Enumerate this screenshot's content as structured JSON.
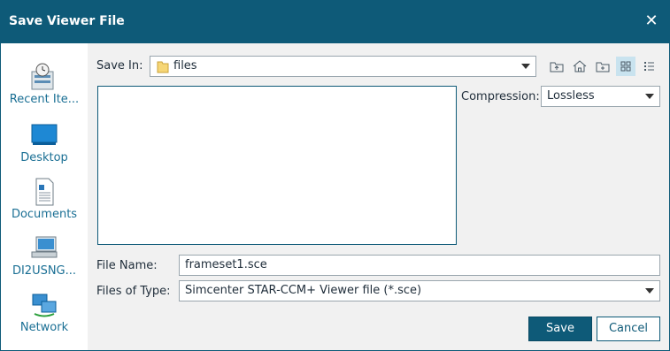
{
  "window": {
    "title": "Save Viewer File",
    "close_icon": "close-icon"
  },
  "sidebar": {
    "items": [
      {
        "label": "Recent Ite...",
        "icon": "recent-items-icon"
      },
      {
        "label": "Desktop",
        "icon": "desktop-icon"
      },
      {
        "label": "Documents",
        "icon": "documents-icon"
      },
      {
        "label": "DI2USNG...",
        "icon": "computer-icon"
      },
      {
        "label": "Network",
        "icon": "network-icon"
      }
    ]
  },
  "save_in": {
    "label": "Save In:",
    "value": "files",
    "icon": "folder-icon"
  },
  "toolbar": {
    "icons": [
      "up-folder-icon",
      "home-icon",
      "new-folder-icon",
      "grid-view-icon",
      "list-view-icon"
    ]
  },
  "compression": {
    "label": "Compression:",
    "value": "Lossless"
  },
  "file_name": {
    "label": "File Name:",
    "value": "frameset1.sce"
  },
  "file_type": {
    "label": "Files of Type:",
    "value": "Simcenter STAR-CCM+ Viewer file (*.sce)"
  },
  "buttons": {
    "save": "Save",
    "cancel": "Cancel"
  },
  "colors": {
    "accent": "#0e5a78",
    "link": "#1a6f94",
    "background": "#f1f1f1"
  }
}
